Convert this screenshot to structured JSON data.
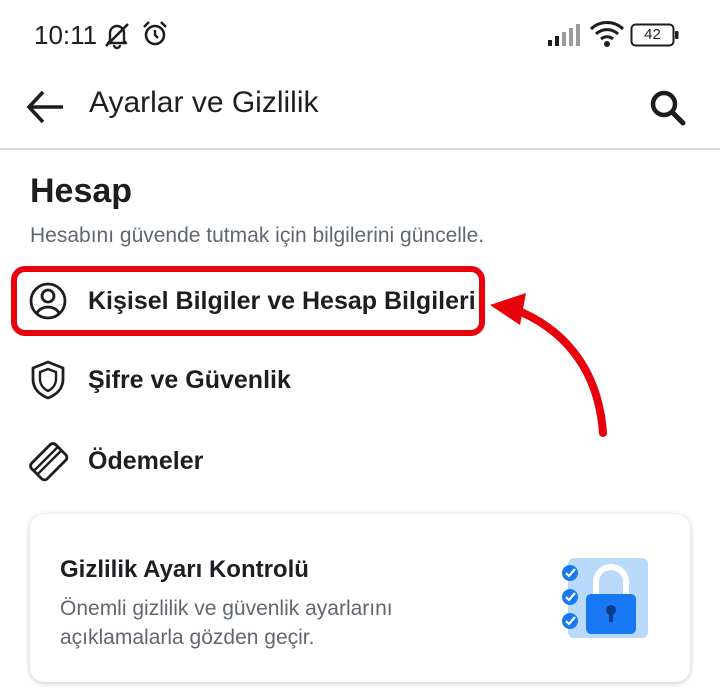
{
  "status_bar": {
    "time": "10:11",
    "battery_level": "42"
  },
  "app_bar": {
    "title": "Ayarlar ve Gizlilik"
  },
  "section": {
    "title": "Hesap",
    "subtitle": "Hesabını güvende tutmak için bilgilerini güncelle."
  },
  "menu_items": [
    {
      "label": "Kişisel Bilgiler ve Hesap Bilgileri",
      "icon": "person-circle-icon"
    },
    {
      "label": "Şifre ve Güvenlik",
      "icon": "shield-icon"
    },
    {
      "label": "Ödemeler",
      "icon": "credit-card-icon"
    }
  ],
  "privacy_card": {
    "title": "Gizlilik Ayarı Kontrolü",
    "description": "Önemli gizlilik ve güvenlik ayarlarını açıklamalarla gözden geçir.",
    "icon": "privacy-checklist-lock-icon"
  },
  "colors": {
    "highlight": "#e8000b",
    "accent_blue": "#1877f2",
    "light_blue": "#8fc2f5",
    "text_primary": "#1c1e21",
    "text_secondary": "#606770"
  }
}
